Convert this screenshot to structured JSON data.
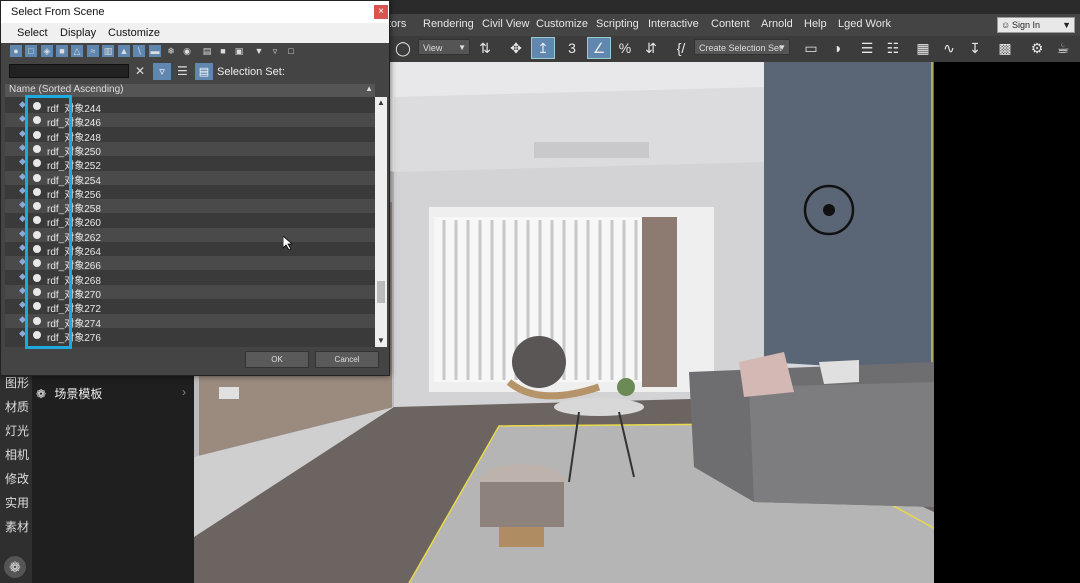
{
  "menubar": {
    "items": [
      "tors",
      "Rendering",
      "Civil View",
      "Customize",
      "Scripting",
      "Interactive",
      "Content",
      "Arnold",
      "Help",
      "Lged Work"
    ],
    "sign_in": "Sign In"
  },
  "toolbar": {
    "view_dropdown": "View",
    "selection_set_dropdown": "Create Selection Set",
    "snap_label": "3",
    "percent_label": "%"
  },
  "left_panel": {
    "labels": [
      "图形",
      "材质",
      "灯光",
      "相机",
      "修改",
      "实用",
      "素材"
    ],
    "scene_template": "场景模板"
  },
  "dialog": {
    "title": "Select From Scene",
    "close": "×",
    "menu": [
      "Select",
      "Display",
      "Customize"
    ],
    "search_value": "",
    "selection_set_label": "Selection Set:",
    "column_header": "Name (Sorted Ascending)",
    "rows": [
      "rdf_对象244",
      "rdf_对象246",
      "rdf_对象248",
      "rdf_对象250",
      "rdf_对象252",
      "rdf_对象254",
      "rdf_对象256",
      "rdf_对象258",
      "rdf_对象260",
      "rdf_对象262",
      "rdf_对象264",
      "rdf_对象266",
      "rdf_对象268",
      "rdf_对象270",
      "rdf_对象272",
      "rdf_对象274",
      "rdf_对象276"
    ],
    "ok_label": "OK",
    "cancel_label": "Cancel"
  },
  "colors": {
    "accent": "#5f87b0",
    "highlight": "#1ea9e0",
    "selection_box": "#e8d84a"
  }
}
